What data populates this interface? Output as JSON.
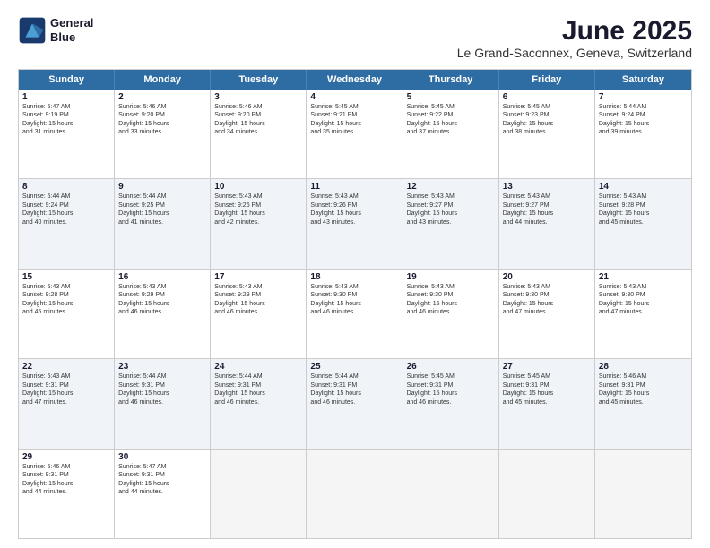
{
  "logo": {
    "line1": "General",
    "line2": "Blue"
  },
  "title": "June 2025",
  "subtitle": "Le Grand-Saconnex, Geneva, Switzerland",
  "weekdays": [
    "Sunday",
    "Monday",
    "Tuesday",
    "Wednesday",
    "Thursday",
    "Friday",
    "Saturday"
  ],
  "rows": [
    [
      {
        "day": "1",
        "lines": [
          "Sunrise: 5:47 AM",
          "Sunset: 9:19 PM",
          "Daylight: 15 hours",
          "and 31 minutes."
        ]
      },
      {
        "day": "2",
        "lines": [
          "Sunrise: 5:46 AM",
          "Sunset: 9:20 PM",
          "Daylight: 15 hours",
          "and 33 minutes."
        ]
      },
      {
        "day": "3",
        "lines": [
          "Sunrise: 5:46 AM",
          "Sunset: 9:20 PM",
          "Daylight: 15 hours",
          "and 34 minutes."
        ]
      },
      {
        "day": "4",
        "lines": [
          "Sunrise: 5:45 AM",
          "Sunset: 9:21 PM",
          "Daylight: 15 hours",
          "and 35 minutes."
        ]
      },
      {
        "day": "5",
        "lines": [
          "Sunrise: 5:45 AM",
          "Sunset: 9:22 PM",
          "Daylight: 15 hours",
          "and 37 minutes."
        ]
      },
      {
        "day": "6",
        "lines": [
          "Sunrise: 5:45 AM",
          "Sunset: 9:23 PM",
          "Daylight: 15 hours",
          "and 38 minutes."
        ]
      },
      {
        "day": "7",
        "lines": [
          "Sunrise: 5:44 AM",
          "Sunset: 9:24 PM",
          "Daylight: 15 hours",
          "and 39 minutes."
        ]
      }
    ],
    [
      {
        "day": "8",
        "lines": [
          "Sunrise: 5:44 AM",
          "Sunset: 9:24 PM",
          "Daylight: 15 hours",
          "and 40 minutes."
        ]
      },
      {
        "day": "9",
        "lines": [
          "Sunrise: 5:44 AM",
          "Sunset: 9:25 PM",
          "Daylight: 15 hours",
          "and 41 minutes."
        ]
      },
      {
        "day": "10",
        "lines": [
          "Sunrise: 5:43 AM",
          "Sunset: 9:26 PM",
          "Daylight: 15 hours",
          "and 42 minutes."
        ]
      },
      {
        "day": "11",
        "lines": [
          "Sunrise: 5:43 AM",
          "Sunset: 9:26 PM",
          "Daylight: 15 hours",
          "and 43 minutes."
        ]
      },
      {
        "day": "12",
        "lines": [
          "Sunrise: 5:43 AM",
          "Sunset: 9:27 PM",
          "Daylight: 15 hours",
          "and 43 minutes."
        ]
      },
      {
        "day": "13",
        "lines": [
          "Sunrise: 5:43 AM",
          "Sunset: 9:27 PM",
          "Daylight: 15 hours",
          "and 44 minutes."
        ]
      },
      {
        "day": "14",
        "lines": [
          "Sunrise: 5:43 AM",
          "Sunset: 9:28 PM",
          "Daylight: 15 hours",
          "and 45 minutes."
        ]
      }
    ],
    [
      {
        "day": "15",
        "lines": [
          "Sunrise: 5:43 AM",
          "Sunset: 9:28 PM",
          "Daylight: 15 hours",
          "and 45 minutes."
        ]
      },
      {
        "day": "16",
        "lines": [
          "Sunrise: 5:43 AM",
          "Sunset: 9:29 PM",
          "Daylight: 15 hours",
          "and 46 minutes."
        ]
      },
      {
        "day": "17",
        "lines": [
          "Sunrise: 5:43 AM",
          "Sunset: 9:29 PM",
          "Daylight: 15 hours",
          "and 46 minutes."
        ]
      },
      {
        "day": "18",
        "lines": [
          "Sunrise: 5:43 AM",
          "Sunset: 9:30 PM",
          "Daylight: 15 hours",
          "and 46 minutes."
        ]
      },
      {
        "day": "19",
        "lines": [
          "Sunrise: 5:43 AM",
          "Sunset: 9:30 PM",
          "Daylight: 15 hours",
          "and 46 minutes."
        ]
      },
      {
        "day": "20",
        "lines": [
          "Sunrise: 5:43 AM",
          "Sunset: 9:30 PM",
          "Daylight: 15 hours",
          "and 47 minutes."
        ]
      },
      {
        "day": "21",
        "lines": [
          "Sunrise: 5:43 AM",
          "Sunset: 9:30 PM",
          "Daylight: 15 hours",
          "and 47 minutes."
        ]
      }
    ],
    [
      {
        "day": "22",
        "lines": [
          "Sunrise: 5:43 AM",
          "Sunset: 9:31 PM",
          "Daylight: 15 hours",
          "and 47 minutes."
        ]
      },
      {
        "day": "23",
        "lines": [
          "Sunrise: 5:44 AM",
          "Sunset: 9:31 PM",
          "Daylight: 15 hours",
          "and 46 minutes."
        ]
      },
      {
        "day": "24",
        "lines": [
          "Sunrise: 5:44 AM",
          "Sunset: 9:31 PM",
          "Daylight: 15 hours",
          "and 46 minutes."
        ]
      },
      {
        "day": "25",
        "lines": [
          "Sunrise: 5:44 AM",
          "Sunset: 9:31 PM",
          "Daylight: 15 hours",
          "and 46 minutes."
        ]
      },
      {
        "day": "26",
        "lines": [
          "Sunrise: 5:45 AM",
          "Sunset: 9:31 PM",
          "Daylight: 15 hours",
          "and 46 minutes."
        ]
      },
      {
        "day": "27",
        "lines": [
          "Sunrise: 5:45 AM",
          "Sunset: 9:31 PM",
          "Daylight: 15 hours",
          "and 45 minutes."
        ]
      },
      {
        "day": "28",
        "lines": [
          "Sunrise: 5:46 AM",
          "Sunset: 9:31 PM",
          "Daylight: 15 hours",
          "and 45 minutes."
        ]
      }
    ],
    [
      {
        "day": "29",
        "lines": [
          "Sunrise: 5:46 AM",
          "Sunset: 9:31 PM",
          "Daylight: 15 hours",
          "and 44 minutes."
        ]
      },
      {
        "day": "30",
        "lines": [
          "Sunrise: 5:47 AM",
          "Sunset: 9:31 PM",
          "Daylight: 15 hours",
          "and 44 minutes."
        ]
      },
      {
        "day": "",
        "lines": []
      },
      {
        "day": "",
        "lines": []
      },
      {
        "day": "",
        "lines": []
      },
      {
        "day": "",
        "lines": []
      },
      {
        "day": "",
        "lines": []
      }
    ]
  ]
}
